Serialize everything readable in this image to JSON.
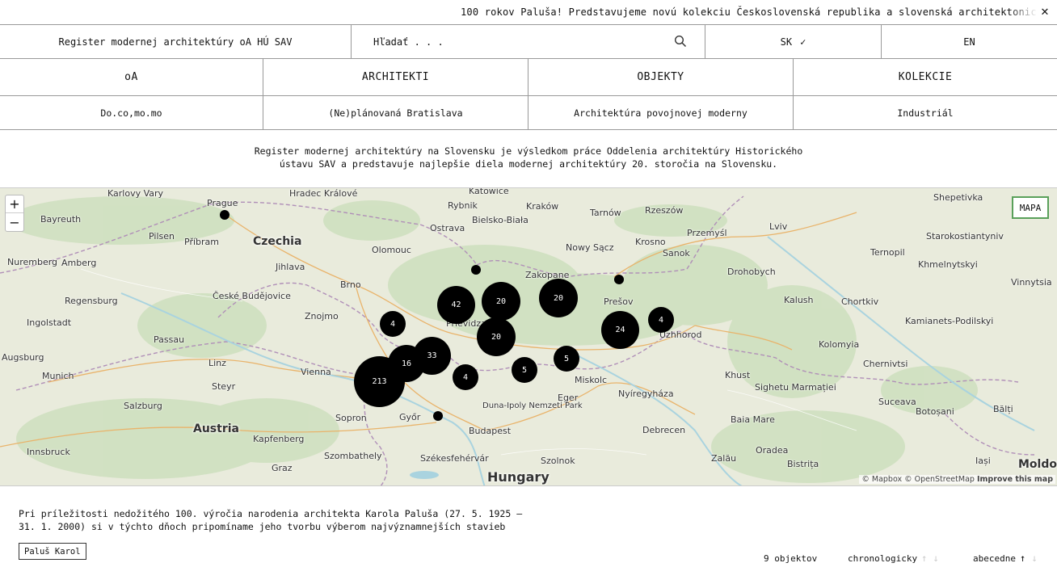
{
  "ticker": {
    "text": "100 rokov Paluša!  Predstavujeme novú kolekciu Československá republika a slovenská architektonická avantgarda",
    "close_glyph": "✕"
  },
  "header": {
    "title": "Register modernej architektúry oA HÚ SAV",
    "search_placeholder": "Hľadať . . .",
    "lang_sk": "SK",
    "lang_en": "EN"
  },
  "nav": {
    "items": [
      {
        "label": "oA"
      },
      {
        "label": "ARCHITEKTI"
      },
      {
        "label": "OBJEKTY"
      },
      {
        "label": "KOLEKCIE"
      }
    ]
  },
  "subnav": {
    "items": [
      {
        "label": "Do.co,mo.mo"
      },
      {
        "label": "(Ne)plánovaná Bratislava"
      },
      {
        "label": "Architektúra povojnovej moderny"
      },
      {
        "label": "Industriál"
      }
    ]
  },
  "intro": {
    "line1": "Register modernej architektúry na Slovensku je výsledkom práce Oddelenia architektúry Historického",
    "line2": "ústavu SAV a predstavuje najlepšie diela modernej architektúry 20. storočia na Slovensku."
  },
  "map": {
    "map_button": "MAPA",
    "zoom_in": "+",
    "zoom_out": "−",
    "attribution_1": "© Mapbox © OpenStreetMap",
    "attribution_2": "Improve this map",
    "countries": [
      {
        "name": "Czechia"
      },
      {
        "name": "Austria"
      },
      {
        "name": "Hungary"
      },
      {
        "name": "Moldov"
      }
    ],
    "cities": [
      {
        "name": "Karlovy Vary"
      },
      {
        "name": "Prague"
      },
      {
        "name": "Bayreuth"
      },
      {
        "name": "Pilsen"
      },
      {
        "name": "Příbram"
      },
      {
        "name": "Nuremberg"
      },
      {
        "name": "Amberg"
      },
      {
        "name": "Regensburg"
      },
      {
        "name": "Ingolstadt"
      },
      {
        "name": "Augsburg"
      },
      {
        "name": "Munich"
      },
      {
        "name": "Passau"
      },
      {
        "name": "Linz"
      },
      {
        "name": "Steyr"
      },
      {
        "name": "Salzburg"
      },
      {
        "name": "Innsbruck"
      },
      {
        "name": "České Budějovice"
      },
      {
        "name": "Jihlava"
      },
      {
        "name": "Brno"
      },
      {
        "name": "Znojmo"
      },
      {
        "name": "Vienna"
      },
      {
        "name": "Olomouc"
      },
      {
        "name": "Ostrava"
      },
      {
        "name": "Katowice"
      },
      {
        "name": "Kraków"
      },
      {
        "name": "Rybnik"
      },
      {
        "name": "Bielsko-Biała"
      },
      {
        "name": "Tarnów"
      },
      {
        "name": "Rzeszów"
      },
      {
        "name": "Zakopane"
      },
      {
        "name": "Nowy Sącz"
      },
      {
        "name": "Krosno"
      },
      {
        "name": "Przemyśl"
      },
      {
        "name": "Sanok"
      },
      {
        "name": "Lviv"
      },
      {
        "name": "Drohobych"
      },
      {
        "name": "Prešov"
      },
      {
        "name": "Uzhhorod"
      },
      {
        "name": "Miskolc"
      },
      {
        "name": "Eger"
      },
      {
        "name": "Nyíregyháza"
      },
      {
        "name": "Debrecen"
      },
      {
        "name": "Budapest"
      },
      {
        "name": "Győr"
      },
      {
        "name": "Sopron"
      },
      {
        "name": "Szolnok"
      },
      {
        "name": "Szombathely"
      },
      {
        "name": "Székesfehérvár"
      },
      {
        "name": "Graz"
      },
      {
        "name": "Kapfenberg"
      },
      {
        "name": "Oradea"
      },
      {
        "name": "Baia Mare"
      },
      {
        "name": "Zalău"
      },
      {
        "name": "Bistrița"
      },
      {
        "name": "Iași"
      },
      {
        "name": "Suceava"
      },
      {
        "name": "Botoșani"
      },
      {
        "name": "Bălți"
      },
      {
        "name": "Chernivtsi"
      },
      {
        "name": "Kolomyia"
      },
      {
        "name": "Kalush"
      },
      {
        "name": "Ternopil"
      },
      {
        "name": "Khmelnytskyi"
      },
      {
        "name": "Vinnytsia"
      },
      {
        "name": "Shepetivka"
      },
      {
        "name": "Starokostiantyniv"
      },
      {
        "name": "Kamianets-Podilskyi"
      },
      {
        "name": "Khust"
      },
      {
        "name": "Sighetu Marmației"
      },
      {
        "name": "Chortkiv"
      },
      {
        "name": "Prievidza"
      },
      {
        "name": "Duna-Ipoly Nemzeti Park"
      },
      {
        "name": "Hradec Králové"
      }
    ],
    "clusters": [
      {
        "count": "213"
      },
      {
        "count": "16"
      },
      {
        "count": "33"
      },
      {
        "count": "4"
      },
      {
        "count": "42"
      },
      {
        "count": "20"
      },
      {
        "count": "20"
      },
      {
        "count": "20"
      },
      {
        "count": "4"
      },
      {
        "count": "5"
      },
      {
        "count": "5"
      },
      {
        "count": "24"
      },
      {
        "count": "4"
      }
    ]
  },
  "footer": {
    "description": "Pri príležitosti nedožitého 100. výročia narodenia architekta Karola Paluša (27. 5. 1925 – 31. 1. 2000) si v týchto dňoch pripomíname jeho tvorbu výberom najvýznamnejších stavieb",
    "tag": "Paluš Karol",
    "count": "9 objektov",
    "sort_chrono": "chronologicky",
    "sort_alpha": "abecedne"
  },
  "colors": {
    "map_land": "#e9ebdc",
    "map_forest": "#cfe0c0",
    "map_water": "#a9d3df",
    "border": "#999999",
    "map_button_border": "#5aa05a"
  }
}
